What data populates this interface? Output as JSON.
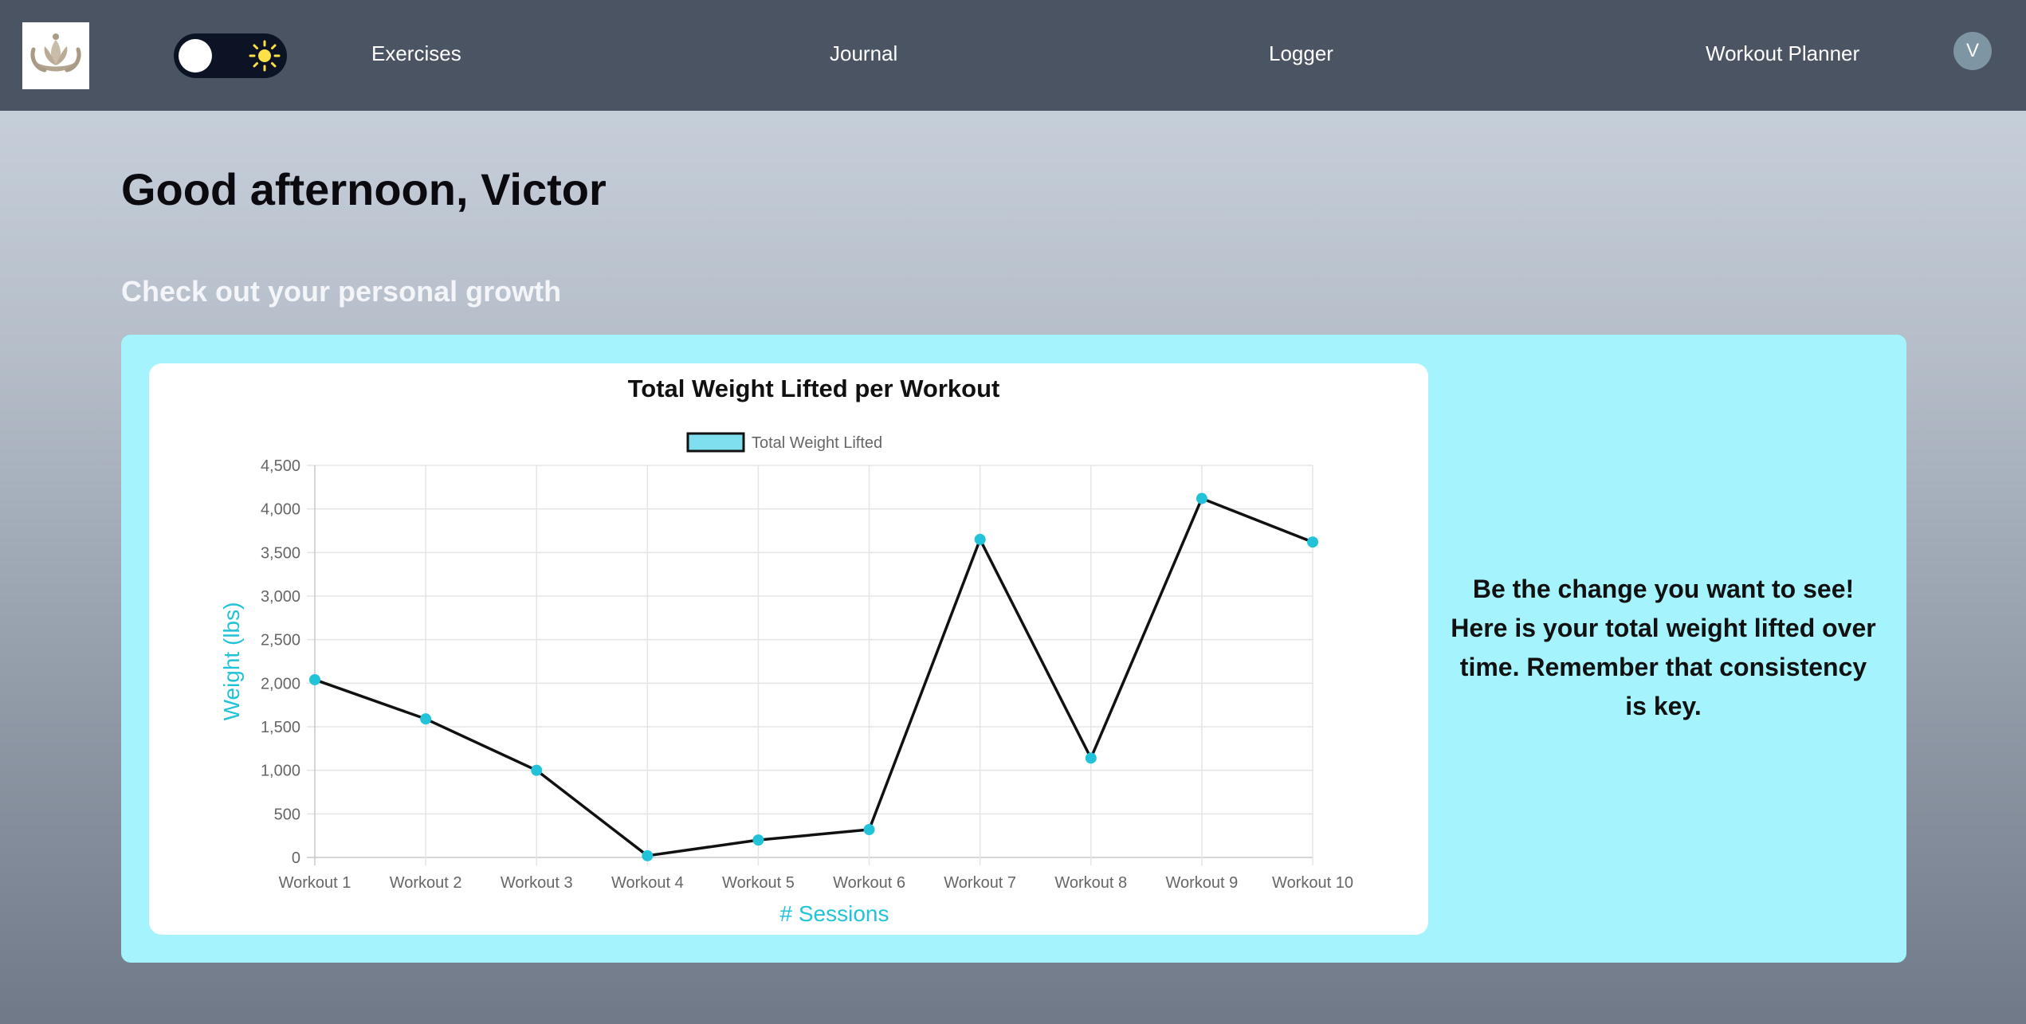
{
  "nav": {
    "links": [
      "Exercises",
      "Journal",
      "Logger",
      "Workout Planner"
    ],
    "avatar_initial": "V"
  },
  "main": {
    "greeting": "Good afternoon, Victor",
    "subheading": "Check out your personal growth",
    "message": "Be the change you want to see! Here is your total weight lifted over time. Remember that consistency is key."
  },
  "colors": {
    "nav_bg": "#4a5463",
    "card_bg": "#a5f3fc",
    "accent": "#22c3d8",
    "line": "#111111",
    "legend_fill": "#7fdfee"
  },
  "icons": {
    "logo": "lotus-hands-logo",
    "theme_toggle": "sun-icon"
  },
  "chart_data": {
    "type": "line",
    "title": "Total Weight Lifted per Workout",
    "xlabel": "# Sessions",
    "ylabel": "Weight (lbs)",
    "legend": "top-center",
    "grid": true,
    "ylim": [
      0,
      4500
    ],
    "yticks": [
      "0",
      "500",
      "1,000",
      "1,500",
      "2,000",
      "2,500",
      "3,000",
      "3,500",
      "4,000",
      "4,500"
    ],
    "categories": [
      "Workout 1",
      "Workout 2",
      "Workout 3",
      "Workout 4",
      "Workout 5",
      "Workout 6",
      "Workout 7",
      "Workout 8",
      "Workout 9",
      "Workout 10"
    ],
    "series": [
      {
        "name": "Total Weight Lifted",
        "values": [
          2040,
          1590,
          1000,
          20,
          200,
          320,
          3650,
          1140,
          4120,
          3620
        ]
      }
    ]
  }
}
